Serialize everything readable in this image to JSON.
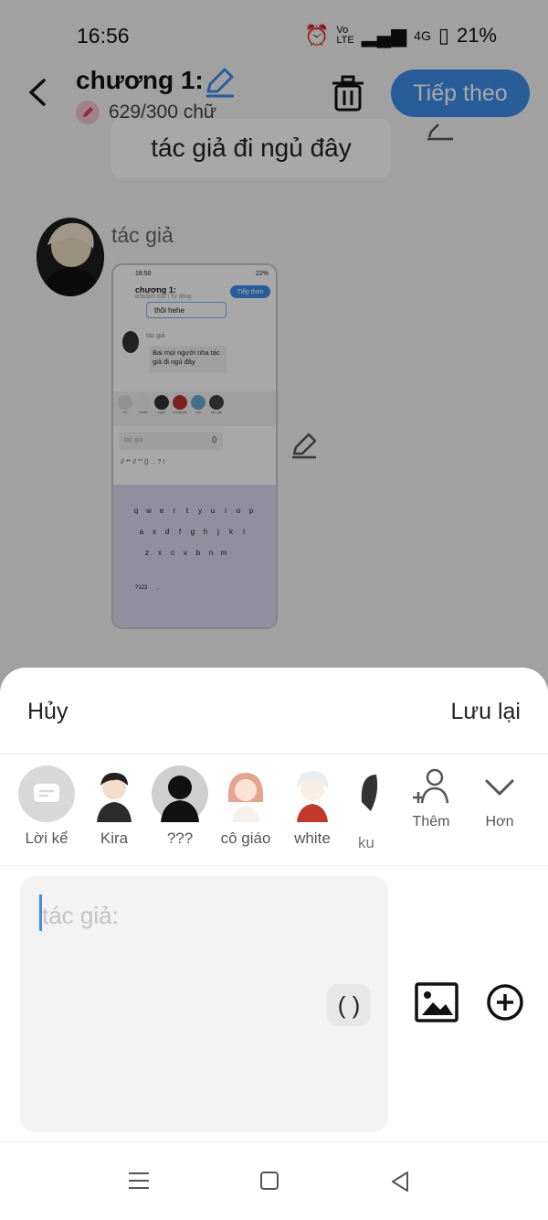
{
  "status": {
    "time": "16:56",
    "network": "4G",
    "battery": "21%"
  },
  "header": {
    "title": "chương 1:",
    "word_count": "629/300 chữ",
    "next_label": "Tiếp theo"
  },
  "story": {
    "bubble_text": "tác giả đi ngủ đây",
    "author_name": "tác giả"
  },
  "inner_screenshot": {
    "time": "16:50",
    "battery": "22%",
    "title": "chương 1:",
    "word_count": "606/300 chữ | Tự động",
    "next_label": "Tiếp theo",
    "bubble1": "thôi hehe",
    "author": "tác giả",
    "bubble2": "Bai mọi người nha tác giả đi ngủ đây",
    "characters": [
      "ro",
      "white",
      "kuku",
      "songbak",
      "việt",
      "tác giả"
    ],
    "more_labels": [
      "Thêm",
      "Hơn"
    ],
    "input_placeholder": "tác giả",
    "paren": "()",
    "sym_row": "// ** // \"\" () ... ? !",
    "key_rows": [
      [
        "q",
        "w",
        "e",
        "r",
        "t",
        "y",
        "u",
        "i",
        "o",
        "p"
      ],
      [
        "a",
        "s",
        "d",
        "f",
        "g",
        "h",
        "j",
        "k",
        "l"
      ],
      [
        "z",
        "x",
        "c",
        "v",
        "b",
        "n",
        "m"
      ]
    ],
    "key_bottom": [
      "?123",
      ","
    ]
  },
  "sheet": {
    "cancel_label": "Hủy",
    "save_label": "Lưu lại",
    "characters": [
      {
        "label": "Lời kể",
        "icon": "narration-icon"
      },
      {
        "label": "Kira"
      },
      {
        "label": "???"
      },
      {
        "label": "cô giáo"
      },
      {
        "label": "white"
      },
      {
        "label": "ku"
      }
    ],
    "add_label": "Thêm",
    "more_label": "Hơn",
    "input_placeholder": "tác giả:",
    "paren_label": "( )"
  },
  "colors": {
    "accent": "#3f8eea",
    "overlay": "rgba(0,0,0,0.34)"
  }
}
